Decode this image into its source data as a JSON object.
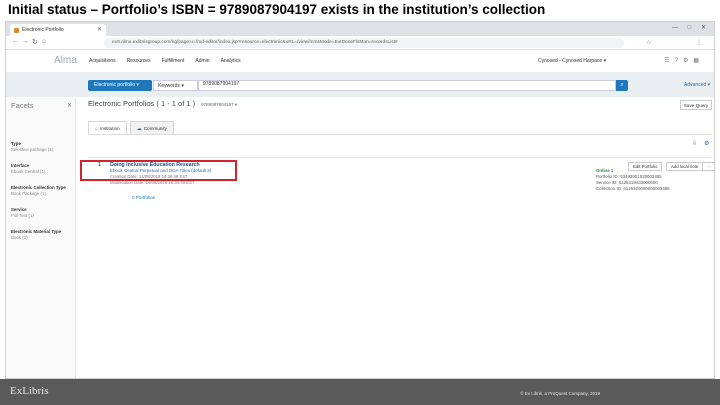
{
  "slide_title": "Initial status – Portfolio’s ISBN = 9789087904197 exists in the institution’s collection",
  "browser": {
    "tab_title": "Electronic Portfolio",
    "url": "ex9.alma.exlibrisgroup.com/ng/page;u=/md-editor/index.jsp?resource=electronic&uRL=/view/mmsMode=ExtDoneFlsMan=recordsList#",
    "win_controls": "— □ ✕"
  },
  "header": {
    "logo": "Alma",
    "nav": [
      "Acquisitions",
      "Resources",
      "Fulfillment",
      "Admin",
      "Analytics"
    ],
    "user": "Cynosed - Cynosed Harpace ▾"
  },
  "search": {
    "type": "Electronic portfolio ▾",
    "field": "Keywords ▾",
    "query": "9789087904197",
    "advanced": "Advanced ▾"
  },
  "facets": {
    "title": "Facets",
    "groups": [
      {
        "header": "Type",
        "value": "Selective package (1)"
      },
      {
        "header": "Interface",
        "value": "Ebook Central (1)"
      },
      {
        "header": "Electronic Collection Type",
        "value": "Book Package (1)"
      },
      {
        "header": "Service",
        "value": "Full Text (1)"
      },
      {
        "header": "Electronic Material Type",
        "value": "Book (1)"
      }
    ]
  },
  "main": {
    "results_header": "Electronic Portfolios ( 1 - 1 of 1 )",
    "results_query": "9789087904197 ▾",
    "save_button": "Save Query",
    "tabs": [
      {
        "label": "Institution",
        "icon": "⌂"
      },
      {
        "label": "Community",
        "icon": "☁"
      }
    ],
    "result": {
      "number": "1",
      "title": "Doing Inclusive Education Research",
      "collection": "Ebook Central Perpetual and DDA Titles (default.it)",
      "creation_date": "Creation Date: 14/08/2018 18:36:49 EST",
      "modification_date": "Modification Date: 14/08/2018 18:36:49 EST",
      "portfolios_link": "0 Portfolios",
      "availability": "Online 1",
      "portfolio_id": "Portfolio ID: 53493901530003485",
      "service_id": "Service ID: 6125319433000000",
      "collection_id": "Collection ID: 6125320000000003485",
      "buttons": [
        "Edit Portfolio",
        "Add local note",
        "···"
      ]
    }
  },
  "footer": {
    "logo": "ExLibris",
    "copyright": "© Ex Libris, a ProQuest Company, 2019"
  }
}
